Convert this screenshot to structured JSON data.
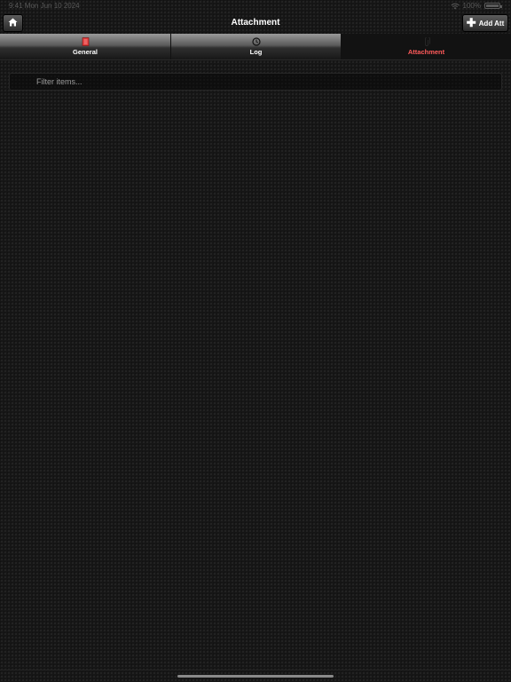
{
  "status_bar": {
    "time": "9:41 Mon Jun 10 2024",
    "battery": "100%",
    "battery_level": 1.0,
    "wifi_icon": "wifi-icon",
    "battery_icon": "battery-icon"
  },
  "nav": {
    "title": "Attachment",
    "home_icon": "home-icon",
    "add_button_label": "Add Att",
    "add_icon": "plus-icon"
  },
  "tabs": [
    {
      "label": "General",
      "icon": "document-icon",
      "icon_color": "#e03a3a",
      "active": false
    },
    {
      "label": "Log",
      "icon": "clock-icon",
      "icon_color": "#111111",
      "active": false
    },
    {
      "label": "Attachment",
      "icon": "paperclip-icon",
      "icon_color": "#2a2a2a",
      "active": true
    }
  ],
  "filter": {
    "placeholder": "Filter items...",
    "value": ""
  },
  "colors": {
    "active_tab_label": "#ff5a5a",
    "background": "#161616"
  }
}
